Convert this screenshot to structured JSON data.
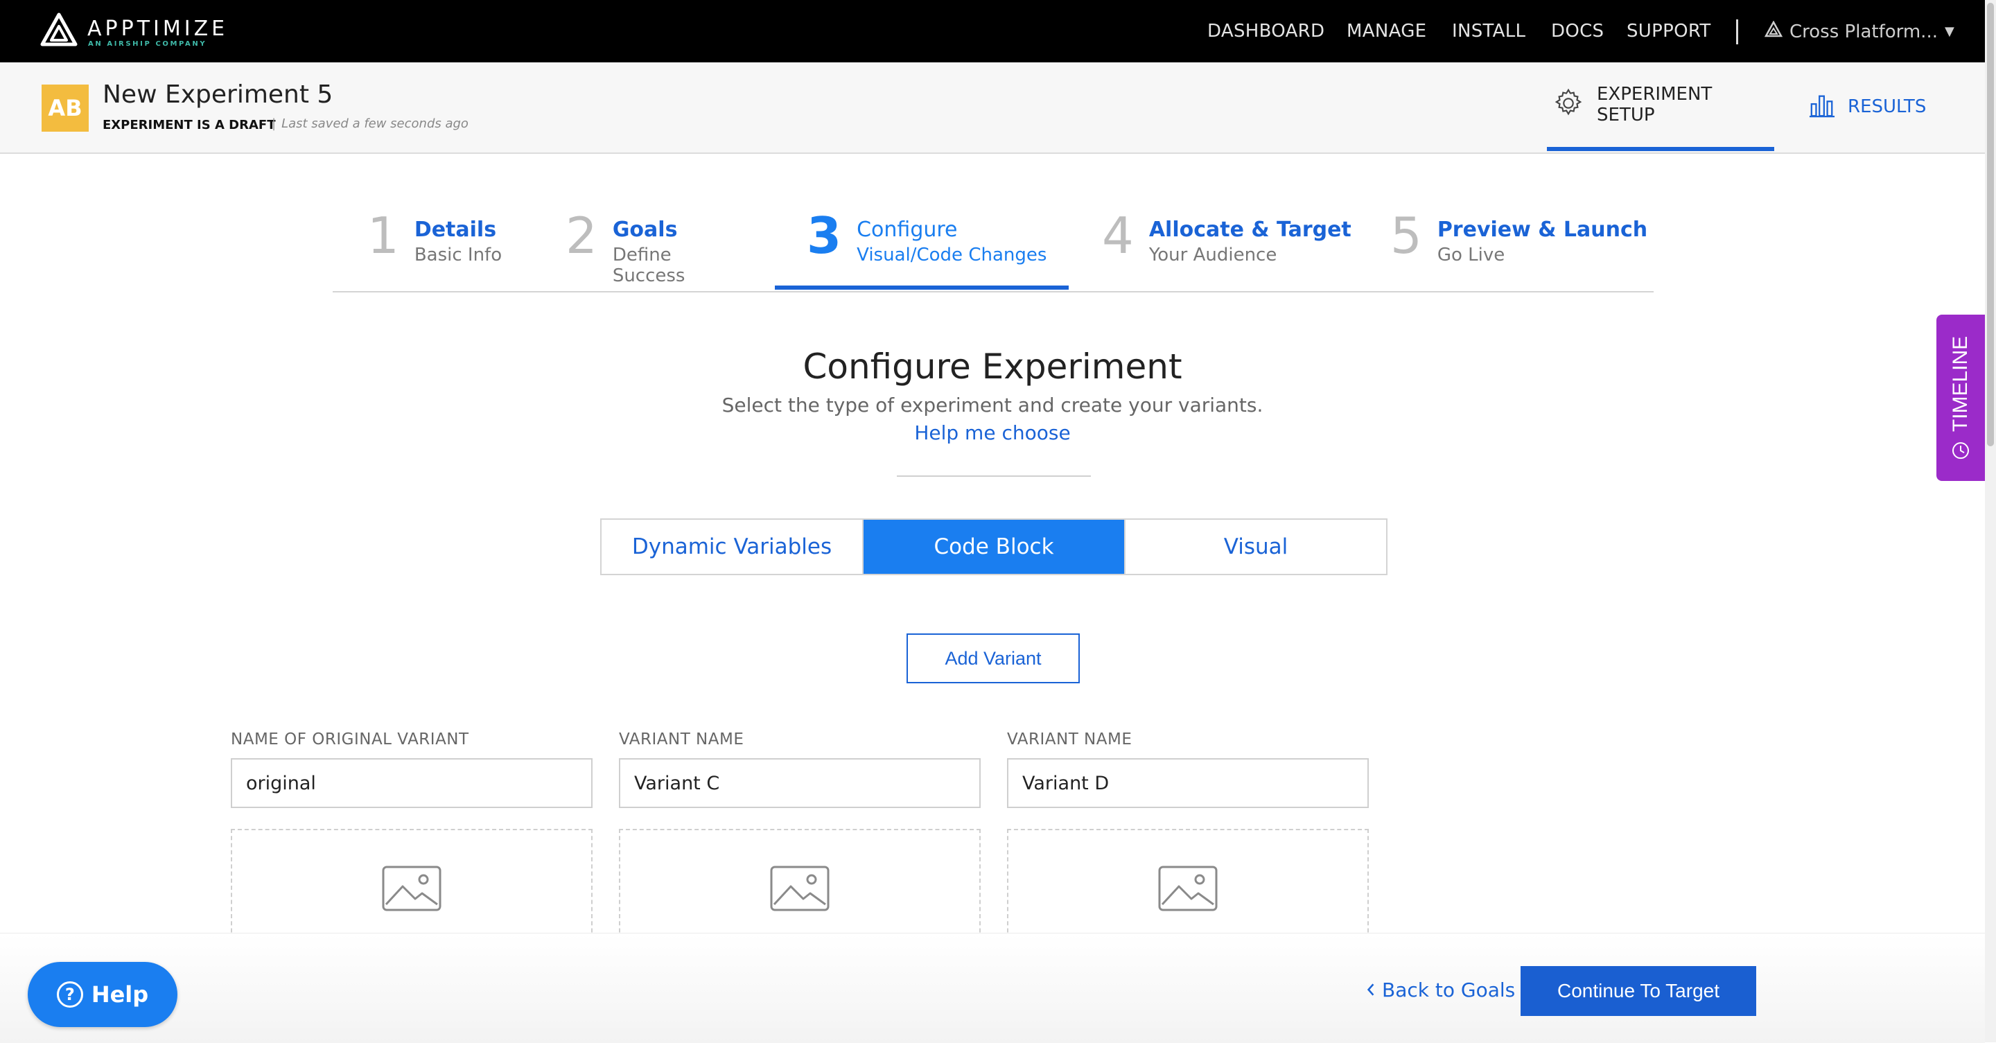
{
  "topnav": {
    "brand": "APPTIMIZE",
    "brand_sub": "AN AIRSHIP COMPANY",
    "links": [
      "DASHBOARD",
      "MANAGE",
      "INSTALL",
      "DOCS",
      "SUPPORT"
    ],
    "platform": "Cross Platform..."
  },
  "header": {
    "badge": "AB",
    "experiment_name": "New Experiment 5",
    "status": "EXPERIMENT IS A DRAFT",
    "separator": "|",
    "saved": "Last saved a few seconds ago",
    "setup_tab": "EXPERIMENT SETUP",
    "results_tab": "RESULTS"
  },
  "steps": [
    {
      "num": "1",
      "title": "Details",
      "sub": "Basic Info",
      "active": false
    },
    {
      "num": "2",
      "title": "Goals",
      "sub": "Define Success",
      "active": false
    },
    {
      "num": "3",
      "title": "Configure",
      "sub": "Visual/Code Changes",
      "active": true
    },
    {
      "num": "4",
      "title": "Allocate & Target",
      "sub": "Your Audience",
      "active": false
    },
    {
      "num": "5",
      "title": "Preview & Launch",
      "sub": "Go Live",
      "active": false
    }
  ],
  "configure": {
    "title": "Configure Experiment",
    "subtitle": "Select the type of experiment and create your variants.",
    "help_link": "Help me choose",
    "types": [
      "Dynamic Variables",
      "Code Block",
      "Visual"
    ],
    "selected_type": "Code Block",
    "add_variant": "Add Variant"
  },
  "variants": [
    {
      "label": "NAME OF ORIGINAL VARIANT",
      "value": "original"
    },
    {
      "label": "VARIANT NAME",
      "value": "Variant C"
    },
    {
      "label": "VARIANT NAME",
      "value": "Variant D"
    }
  ],
  "footer": {
    "help": "Help",
    "back": "Back to Goals",
    "continue": "Continue To Target"
  },
  "timeline": "TIMELINE",
  "colors": {
    "nav_bg": "#000000",
    "accent_blue": "#1a63d6",
    "active_blue": "#1a7ef0",
    "badge_yellow": "#f3bc3f",
    "timeline_purple": "#9b2bc9"
  }
}
